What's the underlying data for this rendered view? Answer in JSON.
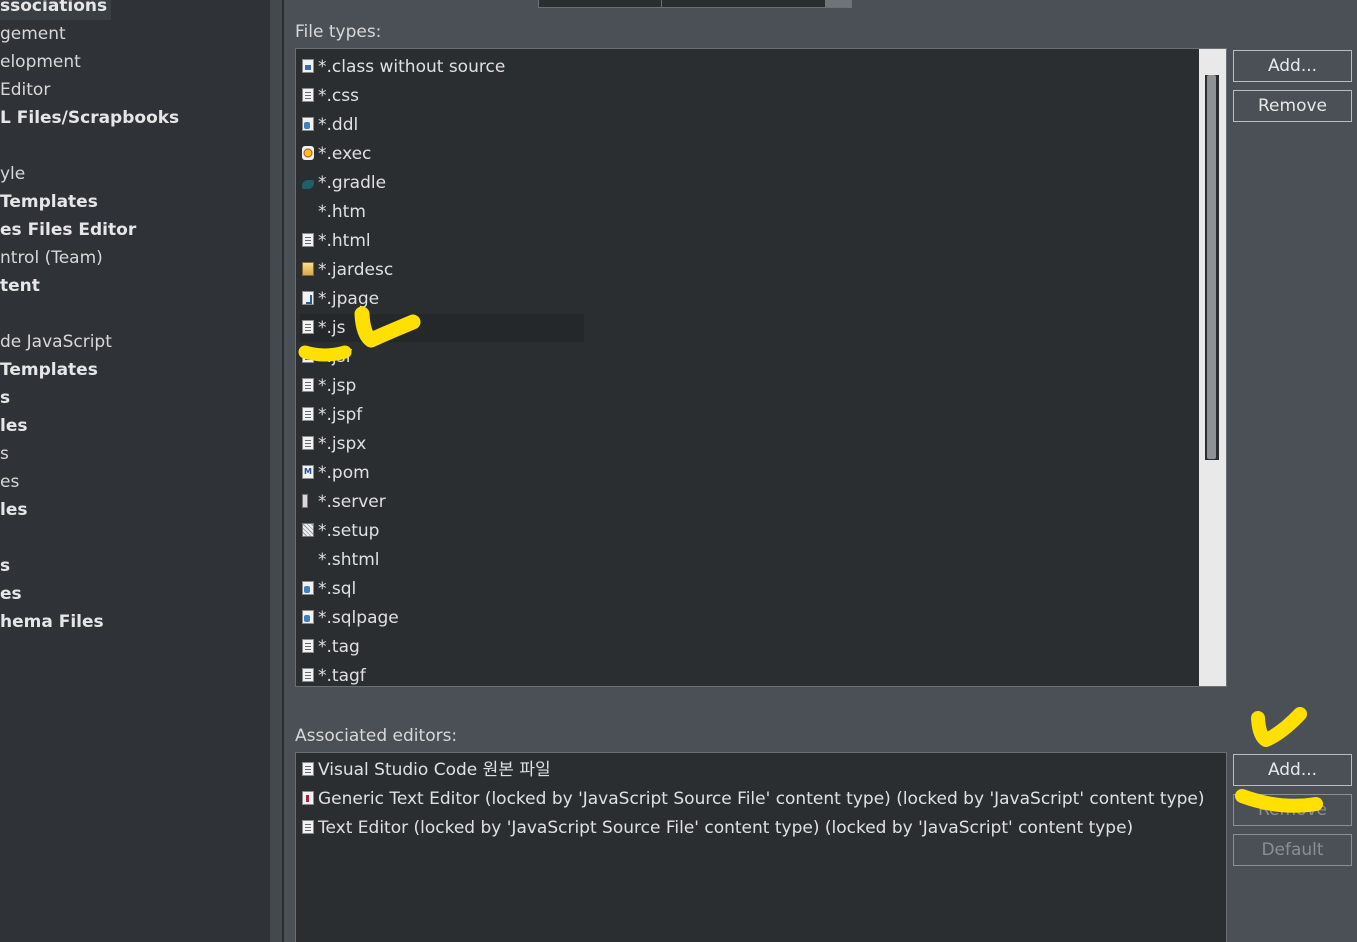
{
  "tree": {
    "items": [
      {
        "label": "ssociations",
        "bold": true,
        "selected": true
      },
      {
        "label": "gement",
        "bold": false
      },
      {
        "label": "elopment",
        "bold": false
      },
      {
        "label": "Editor",
        "bold": false
      },
      {
        "label": "L Files/Scrapbooks",
        "bold": true
      },
      {
        "label": "",
        "bold": false
      },
      {
        "label": "yle",
        "bold": false
      },
      {
        "label": " Templates",
        "bold": true
      },
      {
        "label": "es Files Editor",
        "bold": true
      },
      {
        "label": "ntrol (Team)",
        "bold": false
      },
      {
        "label": "tent",
        "bold": true
      },
      {
        "label": "",
        "bold": false
      },
      {
        "label": "de JavaScript",
        "bold": false
      },
      {
        "label": " Templates",
        "bold": true
      },
      {
        "label": "s",
        "bold": true
      },
      {
        "label": "les",
        "bold": true
      },
      {
        "label": "s",
        "bold": false
      },
      {
        "label": "es",
        "bold": false
      },
      {
        "label": "les",
        "bold": true
      },
      {
        "label": "",
        "bold": false
      },
      {
        "label": "s",
        "bold": true
      },
      {
        "label": "es",
        "bold": true
      },
      {
        "label": "hema Files",
        "bold": true
      }
    ]
  },
  "file_types": {
    "label": "File types:",
    "items": [
      {
        "label": "*.class without source",
        "icon": "class-file-icon"
      },
      {
        "label": "*.css",
        "icon": "text-file-icon"
      },
      {
        "label": "*.ddl",
        "icon": "sql-file-icon"
      },
      {
        "label": "*.exec",
        "icon": "exec-gear-icon"
      },
      {
        "label": "*.gradle",
        "icon": "gradle-elephant-icon"
      },
      {
        "label": "*.htm",
        "icon": "web-globe-icon"
      },
      {
        "label": "*.html",
        "icon": "text-file-icon"
      },
      {
        "label": "*.jardesc",
        "icon": "jar-description-icon"
      },
      {
        "label": "*.jpage",
        "icon": "java-page-icon"
      },
      {
        "label": "*.js",
        "icon": "text-file-icon"
      },
      {
        "label": "*.jsf",
        "icon": "text-file-icon"
      },
      {
        "label": "*.jsp",
        "icon": "text-file-icon"
      },
      {
        "label": "*.jspf",
        "icon": "text-file-icon"
      },
      {
        "label": "*.jspx",
        "icon": "text-file-icon"
      },
      {
        "label": "*.pom",
        "icon": "maven-pom-icon"
      },
      {
        "label": "*.server",
        "icon": "server-icon"
      },
      {
        "label": "*.setup",
        "icon": "setup-file-icon"
      },
      {
        "label": "*.shtml",
        "icon": "web-globe-icon"
      },
      {
        "label": "*.sql",
        "icon": "sql-file-icon"
      },
      {
        "label": "*.sqlpage",
        "icon": "sql-file-icon"
      },
      {
        "label": "*.tag",
        "icon": "text-file-icon"
      },
      {
        "label": "*.tagf",
        "icon": "text-file-icon"
      }
    ],
    "selected_index": 9,
    "add_label": "Add...",
    "remove_label": "Remove"
  },
  "associated_editors": {
    "label": "Associated editors:",
    "items": [
      {
        "label": "Visual Studio Code 원본 파일",
        "icon": "text-file-icon"
      },
      {
        "label": "Generic Text Editor (locked by 'JavaScript Source File' content type) (locked by 'JavaScript' content type)",
        "icon": "generic-editor-icon"
      },
      {
        "label": "Text Editor (locked by 'JavaScript Source File' content type) (locked by 'JavaScript' content type)",
        "icon": "text-file-icon"
      }
    ],
    "add_label": "Add...",
    "remove_label": "Remove",
    "default_label": "Default"
  },
  "colors": {
    "annotation": "#ffe000",
    "panel_bg": "#4a5055",
    "list_bg": "#2b2e31"
  }
}
